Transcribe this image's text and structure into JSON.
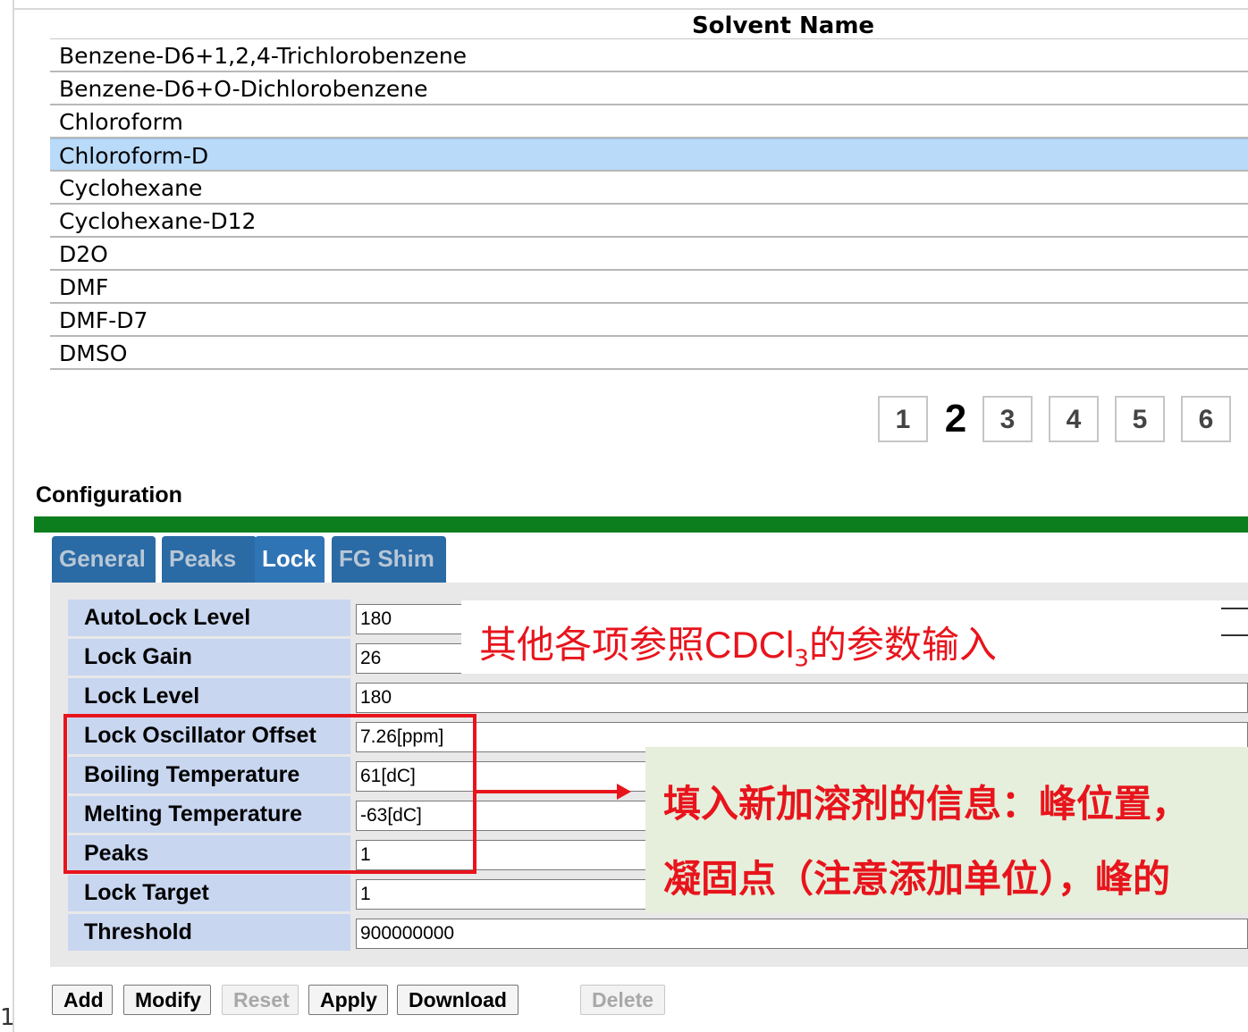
{
  "solvents": {
    "header": "Solvent Name",
    "rows": [
      "Benzene-D6+1,2,4-Trichlorobenzene",
      "Benzene-D6+O-Dichlorobenzene",
      "Chloroform",
      "Chloroform-D",
      "Cyclohexane",
      "Cyclohexane-D12",
      "D2O",
      "DMF",
      "DMF-D7",
      "DMSO"
    ],
    "selected": "Chloroform-D"
  },
  "pagination": {
    "pages": [
      "1",
      "2",
      "3",
      "4",
      "5",
      "6"
    ],
    "current": "2"
  },
  "configuration": {
    "title": "Configuration",
    "tabs": [
      "General",
      "Peaks",
      "Lock",
      "FG Shim"
    ],
    "active_tab": "Lock",
    "params": [
      {
        "label": "AutoLock Level",
        "value": "180"
      },
      {
        "label": "Lock Gain",
        "value": "26"
      },
      {
        "label": "Lock Level",
        "value": "180"
      },
      {
        "label": "Lock Oscillator Offset",
        "value": "7.26[ppm]"
      },
      {
        "label": "Boiling Temperature",
        "value": "61[dC]"
      },
      {
        "label": "Melting Temperature",
        "value": "-63[dC]"
      },
      {
        "label": "Peaks",
        "value": "1"
      },
      {
        "label": "Lock Target",
        "value": "1"
      },
      {
        "label": "Threshold",
        "value": "900000000"
      }
    ]
  },
  "annotations": {
    "note1_pre": "其他各项参照",
    "note1_formula": "CDCl",
    "note1_sub": "3",
    "note1_post": "的参数输入",
    "note2_line1": "填入新加溶剂的信息：峰位置，",
    "note2_line2": "凝固点（注意添加单位），峰的"
  },
  "buttons": {
    "add": "Add",
    "modify": "Modify",
    "reset": "Reset",
    "apply": "Apply",
    "download": "Download",
    "delete": "Delete"
  },
  "corner_mark": "1",
  "colors": {
    "accent_green": "#0d7e1e",
    "tab_blue": "#2f74b5",
    "selected_row": "#b9daf9",
    "annotation_red": "#e8141c"
  }
}
